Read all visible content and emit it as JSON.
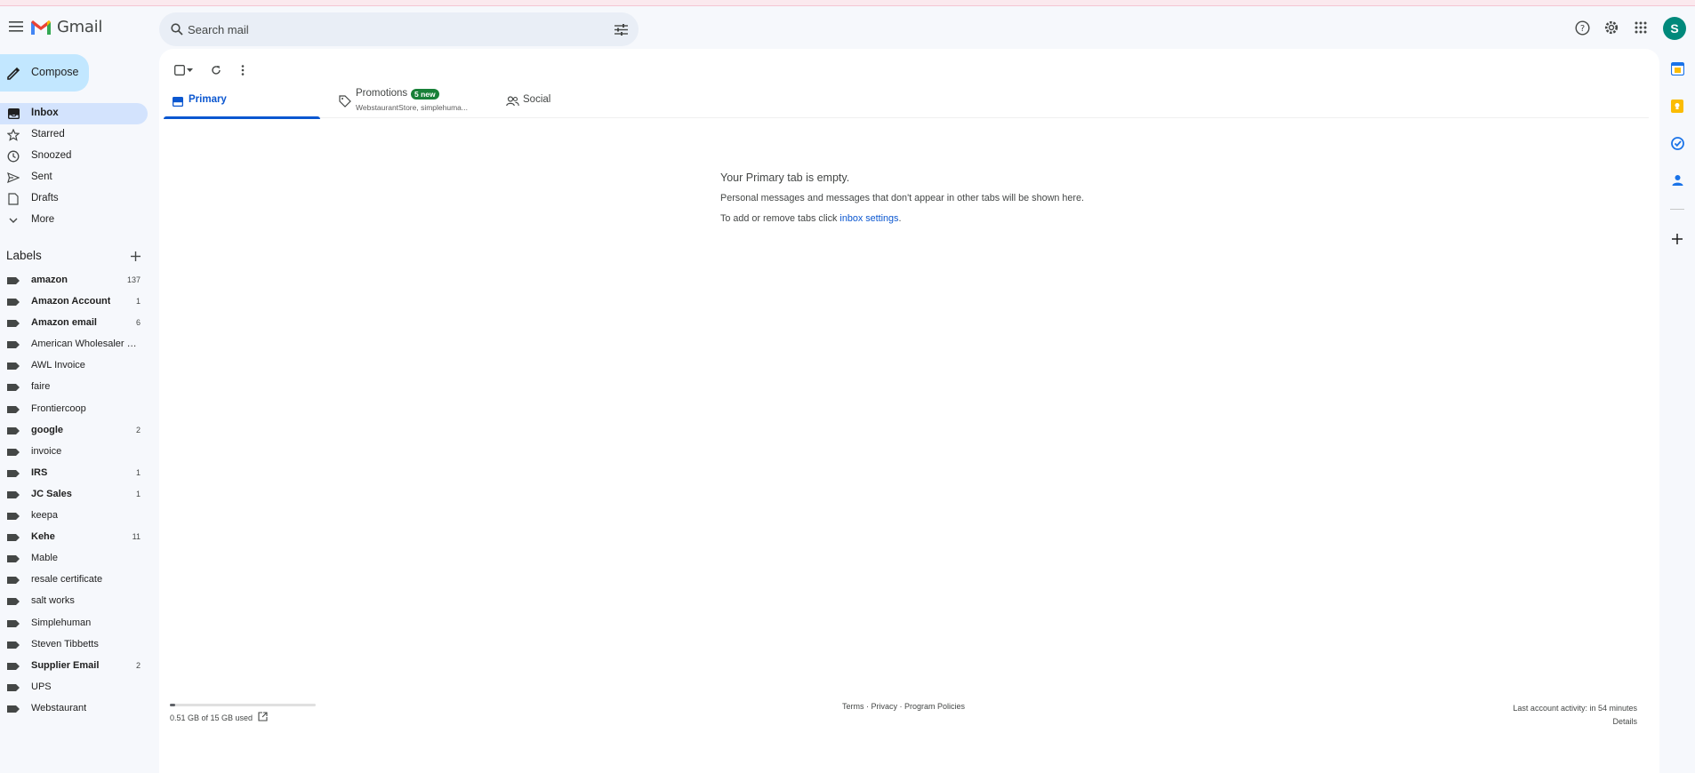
{
  "app": {
    "name": "Gmail"
  },
  "search": {
    "placeholder": "Search mail"
  },
  "account": {
    "avatar_letter": "S",
    "avatar_color": "#00897b"
  },
  "compose": {
    "label": "Compose"
  },
  "nav": {
    "items": [
      {
        "label": "Inbox",
        "icon": "inbox-icon",
        "active": true
      },
      {
        "label": "Starred",
        "icon": "star-icon"
      },
      {
        "label": "Snoozed",
        "icon": "clock-icon"
      },
      {
        "label": "Sent",
        "icon": "send-icon"
      },
      {
        "label": "Drafts",
        "icon": "draft-icon"
      },
      {
        "label": "More",
        "icon": "chevron-down-icon"
      }
    ]
  },
  "labels": {
    "title": "Labels",
    "items": [
      {
        "name": "amazon",
        "count": "137",
        "bold": true
      },
      {
        "name": "Amazon Account",
        "count": "1",
        "bold": true
      },
      {
        "name": "Amazon email",
        "count": "6",
        "bold": true
      },
      {
        "name": "American Wholesaler S...",
        "count": "",
        "bold": false
      },
      {
        "name": "AWL Invoice",
        "count": "",
        "bold": false
      },
      {
        "name": "faire",
        "count": "",
        "bold": false
      },
      {
        "name": "Frontiercoop",
        "count": "",
        "bold": false
      },
      {
        "name": "google",
        "count": "2",
        "bold": true
      },
      {
        "name": "invoice",
        "count": "",
        "bold": false
      },
      {
        "name": "IRS",
        "count": "1",
        "bold": true
      },
      {
        "name": "JC Sales",
        "count": "1",
        "bold": true
      },
      {
        "name": "keepa",
        "count": "",
        "bold": false
      },
      {
        "name": "Kehe",
        "count": "11",
        "bold": true
      },
      {
        "name": "Mable",
        "count": "",
        "bold": false
      },
      {
        "name": "resale certificate",
        "count": "",
        "bold": false
      },
      {
        "name": "salt works",
        "count": "",
        "bold": false
      },
      {
        "name": "Simplehuman",
        "count": "",
        "bold": false
      },
      {
        "name": "Steven Tibbetts",
        "count": "",
        "bold": false
      },
      {
        "name": "Supplier Email",
        "count": "2",
        "bold": true
      },
      {
        "name": "UPS",
        "count": "",
        "bold": false
      },
      {
        "name": "Webstaurant",
        "count": "",
        "bold": false
      }
    ]
  },
  "tabs": {
    "primary": {
      "label": "Primary"
    },
    "promotions": {
      "label": "Promotions",
      "badge": "5 new",
      "senders": "WebstaurantStore, simplehuma..."
    },
    "social": {
      "label": "Social"
    }
  },
  "empty_state": {
    "title": "Your Primary tab is empty.",
    "line1": "Personal messages and messages that don't appear in other tabs will be shown here.",
    "line2_prefix": "To add or remove tabs click ",
    "line2_link": "inbox settings",
    "line2_suffix": "."
  },
  "footer": {
    "storage_text": "0.51 GB of 15 GB used",
    "storage_fraction": 0.034,
    "terms": "Terms",
    "privacy": "Privacy",
    "policies": "Program Policies",
    "sep": " · ",
    "activity": "Last account activity: in 54 minutes",
    "details": "Details"
  },
  "colors": {
    "accent": "#0b57d0",
    "compose_bg": "#c2e7ff",
    "active_nav": "#d3e3fd",
    "badge_green": "#188038"
  }
}
